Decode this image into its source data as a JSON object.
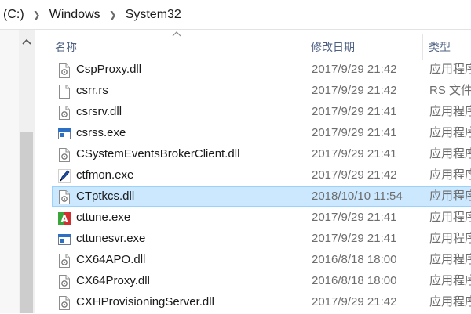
{
  "breadcrumb": {
    "items": [
      "(C:)",
      "Windows",
      "System32"
    ]
  },
  "columns": {
    "name": "名称",
    "date": "修改日期",
    "type": "类型"
  },
  "files": [
    {
      "name": "CspProxy.dll",
      "date": "2017/9/29 21:42",
      "type": "应用程序",
      "icon": "dll-file-icon"
    },
    {
      "name": "csrr.rs",
      "date": "2017/9/29 21:42",
      "type": "RS 文件",
      "icon": "blank-file-icon"
    },
    {
      "name": "csrsrv.dll",
      "date": "2017/9/29 21:41",
      "type": "应用程序",
      "icon": "dll-file-icon"
    },
    {
      "name": "csrss.exe",
      "date": "2017/9/29 21:41",
      "type": "应用程序",
      "icon": "exe-window-icon"
    },
    {
      "name": "CSystemEventsBrokerClient.dll",
      "date": "2017/9/29 21:41",
      "type": "应用程序",
      "icon": "dll-file-icon"
    },
    {
      "name": "ctfmon.exe",
      "date": "2017/9/29 21:42",
      "type": "应用程序",
      "icon": "pen-icon"
    },
    {
      "name": "CTptkcs.dll",
      "date": "2018/10/10 11:54",
      "type": "应用程序",
      "icon": "dll-file-icon"
    },
    {
      "name": "cttune.exe",
      "date": "2017/9/29 21:41",
      "type": "应用程序",
      "icon": "cleartype-tuner-icon"
    },
    {
      "name": "cttunesvr.exe",
      "date": "2017/9/29 21:41",
      "type": "应用程序",
      "icon": "exe-window-icon"
    },
    {
      "name": "CX64APO.dll",
      "date": "2016/8/18 18:00",
      "type": "应用程序",
      "icon": "dll-file-icon"
    },
    {
      "name": "CX64Proxy.dll",
      "date": "2016/8/18 18:00",
      "type": "应用程序",
      "icon": "dll-file-icon"
    },
    {
      "name": "CXHProvisioningServer.dll",
      "date": "2017/9/29 21:42",
      "type": "应用程序",
      "icon": "dll-file-icon"
    }
  ],
  "selected_file": "CTptkcs.dll",
  "colors": {
    "selection_bg": "#cce8ff",
    "selection_border": "#99d1ff",
    "header_text": "#4d6082"
  }
}
